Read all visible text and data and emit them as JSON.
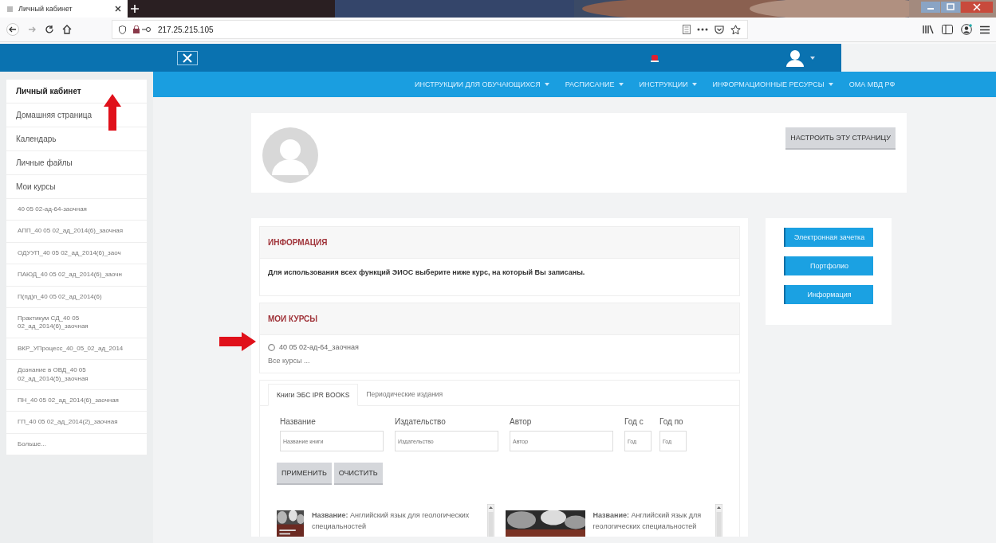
{
  "browser": {
    "tab_title": "Личный кабинет",
    "address": "217.25.215.105"
  },
  "navbar": {
    "menu": [
      {
        "label": "ИНСТРУКЦИИ ДЛЯ ОБУЧАЮЩИХСЯ",
        "dropdown": true
      },
      {
        "label": "РАСПИСАНИЕ",
        "dropdown": true
      },
      {
        "label": "ИНСТРУКЦИИ",
        "dropdown": true
      },
      {
        "label": "ИНФОРМАЦИОННЫЕ РЕСУРСЫ",
        "dropdown": true
      },
      {
        "label": "ОМА МВД РФ",
        "dropdown": false
      }
    ]
  },
  "sidebar": {
    "items": [
      {
        "label": "Личный кабинет",
        "selected": true
      },
      {
        "label": "Домашняя страница",
        "selected": false
      },
      {
        "label": "Календарь",
        "selected": false
      },
      {
        "label": "Личные файлы",
        "selected": false
      },
      {
        "label": "Мои курсы",
        "selected": false,
        "children": [
          {
            "label": "40 05 02-ад-64-заочная",
            "selected": false
          },
          {
            "label": "АПП_40 05 02_ад_2014(6)_заочная",
            "selected": false
          },
          {
            "label": "ОДУУП_40 05 02_ад_2014(6)_заоч",
            "selected": false
          },
          {
            "label": "ПАЮД_40 05 02_ад_2014(6)_заочн",
            "selected": false
          },
          {
            "label": "П(пд)п_40 05 02_ад_2014(6)",
            "selected": false
          },
          {
            "label": "Практикум СД_40 05 02_ад_2014(6)_заочная",
            "selected": false
          },
          {
            "label": "ВКР_УПроцесс_40_05_02_ад_2014",
            "selected": false
          },
          {
            "label": "Дознание в ОВД_40 05 02_ад_2014(5)_заочная",
            "selected": false
          },
          {
            "label": "ПН_40 05 02_ад_2014(6)_заочная",
            "selected": false
          },
          {
            "label": "ГП_40 05 02_ад_2014(2)_заочная",
            "selected": false
          },
          {
            "label": "Больше...",
            "selected": false
          }
        ]
      }
    ]
  },
  "profile": {
    "button": "НАСТРОИТЬ ЭТУ СТРАНИЦУ"
  },
  "info_block": {
    "title": "ИНФОРМАЦИЯ",
    "text": "Для использования всех функций ЭИОС выберите ниже курс, на который Вы записаны."
  },
  "courses_block": {
    "title": "МОИ КУРСЫ",
    "courses": [
      "40 05 02-ад-64_заочная"
    ],
    "all_link": "Все курсы ..."
  },
  "library": {
    "tabs": [
      {
        "label": "Книги ЭБС IPR BOOKS",
        "selected": true
      },
      {
        "label": "Периодические издания",
        "selected": false
      }
    ],
    "filters": [
      {
        "label": "Название",
        "placeholder": "Название книги",
        "kind": "wide"
      },
      {
        "label": "Издательство",
        "placeholder": "Издательство",
        "kind": "wide"
      },
      {
        "label": "Автор",
        "placeholder": "Автор",
        "kind": "wide"
      },
      {
        "label": "Год с",
        "placeholder": "Год",
        "kind": "narrow"
      },
      {
        "label": "Год по",
        "placeholder": "Год",
        "kind": "narrow"
      }
    ],
    "buttons": [
      "ПРИМЕНИТЬ",
      "ОЧИСТИТЬ"
    ],
    "results": [
      {
        "text": "**Название:** Английский язык для геологических специальностей"
      },
      {
        "text": "**Название:** Английский язык для геологических специальностей"
      }
    ]
  },
  "quick_links": [
    "Электронная зачетка",
    "Портфолио",
    "Информация"
  ]
}
